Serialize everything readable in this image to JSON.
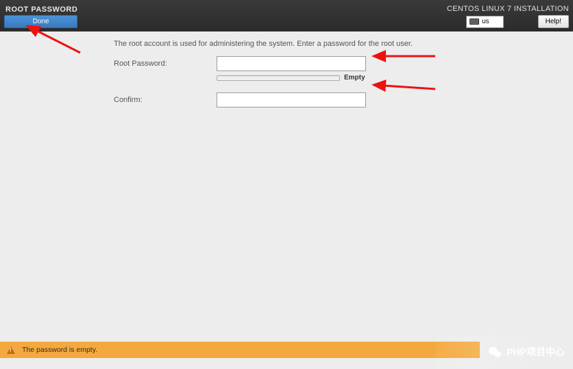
{
  "header": {
    "title": "ROOT PASSWORD",
    "done_label": "Done",
    "install_title": "CENTOS LINUX 7 INSTALLATION",
    "keyboard_layout": "us",
    "help_label": "Help!"
  },
  "content": {
    "info": "The root account is used for administering the system.  Enter a password for the root user.",
    "root_password_label": "Root Password:",
    "root_password_value": "",
    "strength_text": "Empty",
    "confirm_label": "Confirm:",
    "confirm_value": ""
  },
  "warning": {
    "message": "The password is empty."
  },
  "watermark": {
    "text": "PHP项目中心"
  }
}
